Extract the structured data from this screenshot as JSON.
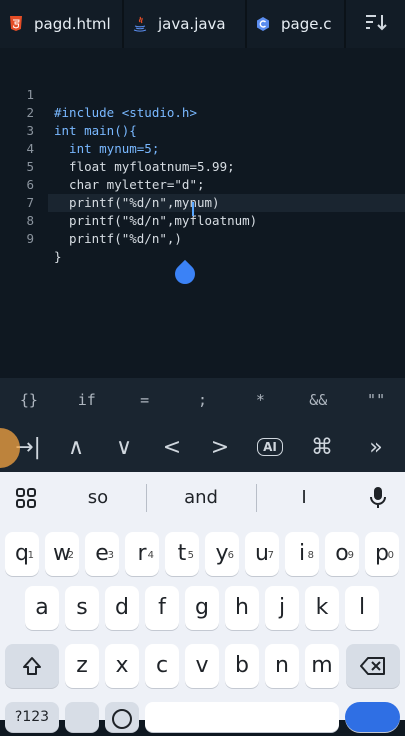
{
  "tabs": [
    {
      "label": "pagd.html",
      "icon": "html5-icon",
      "color": "#e44d26"
    },
    {
      "label": "java.java",
      "icon": "java-icon",
      "color": "#e44d26"
    },
    {
      "label": "page.c",
      "icon": "c-language-icon",
      "color": "#5b8def"
    }
  ],
  "sort_icon": "sort-icon",
  "editor": {
    "line_numbers": [
      "1",
      "2",
      "3",
      "4",
      "5",
      "6",
      "7",
      "8",
      "9"
    ],
    "lines": [
      "#include <studio.h>",
      "int main(){",
      "  int mynum=5;",
      "  float myfloatnum=5.99;",
      "  char myletter=\"d\";",
      "  printf(\"%d/n\",mynum)",
      "  printf(\"%d/n\",myfloatnum)",
      "  printf(\"%d/n\",)",
      "}"
    ],
    "current_line": 8
  },
  "symbols": [
    "{}",
    "if",
    "=",
    ";",
    "*",
    "&&",
    "\"\""
  ],
  "nav_keys": {
    "tab": "→|",
    "up": "∧",
    "down": "∨",
    "left": "<",
    "right": ">",
    "ai": "AI",
    "cmd": "⌘",
    "forward": "»"
  },
  "keyboard": {
    "suggestions": [
      "so",
      "and",
      "I"
    ],
    "row1": [
      [
        "q",
        "1"
      ],
      [
        "w",
        "2"
      ],
      [
        "e",
        "3"
      ],
      [
        "r",
        "4"
      ],
      [
        "t",
        "5"
      ],
      [
        "y",
        "6"
      ],
      [
        "u",
        "7"
      ],
      [
        "i",
        "8"
      ],
      [
        "o",
        "9"
      ],
      [
        "p",
        "0"
      ]
    ],
    "row2": [
      "a",
      "s",
      "d",
      "f",
      "g",
      "h",
      "j",
      "k",
      "l"
    ],
    "row3": [
      "z",
      "x",
      "c",
      "v",
      "b",
      "n",
      "m"
    ],
    "bottom_left": "?123"
  }
}
